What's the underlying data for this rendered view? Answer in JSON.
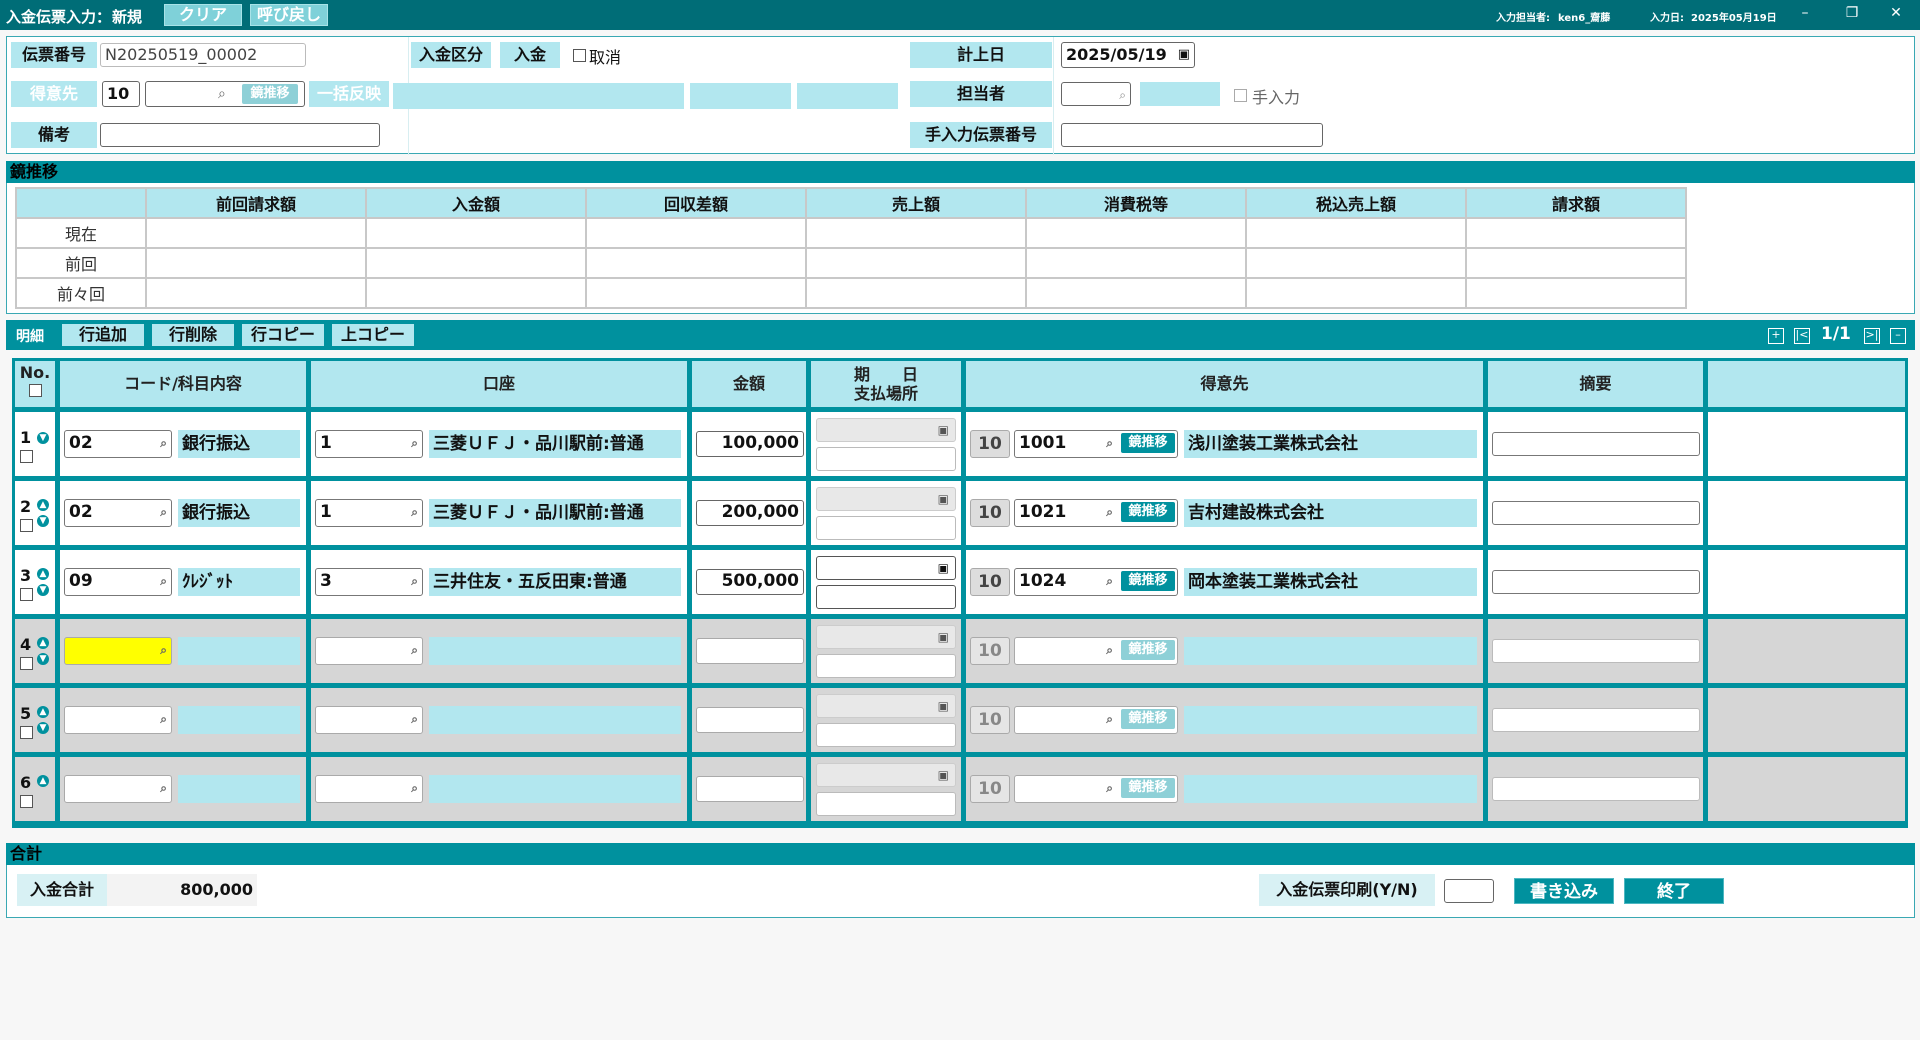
{
  "titlebar": {
    "title": "入金伝票入力：",
    "mode": "新規",
    "clear_label": "クリア",
    "recall_label": "呼び戻し",
    "user_label": "入力担当者:",
    "user_value": "ken6_齋藤",
    "date_label": "入力日:",
    "date_value": "2025年05月19日"
  },
  "header": {
    "slip_no_label": "伝票番号",
    "slip_no_value": "N20250519_00002",
    "kubun_label": "入金区分",
    "kubun_value": "入金",
    "cancel_label": "取消",
    "posting_date_label": "計上日",
    "posting_date_value": "2025/05/19",
    "customer_label": "得意先",
    "customer_code": "10",
    "suii_label": "鏡推移",
    "ikkatsu_label": "一括反映",
    "staff_label": "担当者",
    "manual_label": "手入力",
    "memo_label": "備考",
    "manual_slip_label": "手入力伝票番号"
  },
  "history": {
    "section_label": "鏡推移",
    "columns": [
      "前回請求額",
      "入金額",
      "回収差額",
      "売上額",
      "消費税等",
      "税込売上額",
      "請求額"
    ],
    "rows": [
      "現在",
      "前回",
      "前々回"
    ]
  },
  "details": {
    "section_label": "明細",
    "add_row": "行追加",
    "delete_row": "行削除",
    "copy_row": "行コピー",
    "copy_up": "上コピー",
    "page": "1/1",
    "col_no": "No.",
    "col_code": "コード/科目内容",
    "col_account": "口座",
    "col_amount": "金額",
    "col_date1": "期　　日",
    "col_date2": "支払場所",
    "col_customer": "得意先",
    "col_tekiyo": "摘要",
    "suii_label": "鏡推移",
    "rows": [
      {
        "no": "1",
        "code": "02",
        "item": "銀行振込",
        "acct": "1",
        "acct_name": "三菱ＵＦＪ・品川駅前:普通",
        "amount": "100,000",
        "tk": "10",
        "cust": "1001",
        "cust_name": "浅川塗装工業株式会社"
      },
      {
        "no": "2",
        "code": "02",
        "item": "銀行振込",
        "acct": "1",
        "acct_name": "三菱ＵＦＪ・品川駅前:普通",
        "amount": "200,000",
        "tk": "10",
        "cust": "1021",
        "cust_name": "吉村建設株式会社"
      },
      {
        "no": "3",
        "code": "09",
        "item": "ｸﾚｼﾞｯﾄ",
        "acct": "3",
        "acct_name": "三井住友・五反田東:普通",
        "amount": "500,000",
        "tk": "10",
        "cust": "1024",
        "cust_name": "岡本塗装工業株式会社"
      },
      {
        "no": "4",
        "code": "",
        "item": "",
        "acct": "",
        "acct_name": "",
        "amount": "",
        "tk": "10",
        "cust": "",
        "cust_name": ""
      },
      {
        "no": "5",
        "code": "",
        "item": "",
        "acct": "",
        "acct_name": "",
        "amount": "",
        "tk": "10",
        "cust": "",
        "cust_name": ""
      },
      {
        "no": "6",
        "code": "",
        "item": "",
        "acct": "",
        "acct_name": "",
        "amount": "",
        "tk": "10",
        "cust": "",
        "cust_name": ""
      }
    ]
  },
  "totals": {
    "section_label": "合計",
    "total_label": "入金合計",
    "total_value": "800,000",
    "print_label": "入金伝票印刷(Y/N)",
    "write_label": "書き込み",
    "end_label": "終了"
  }
}
